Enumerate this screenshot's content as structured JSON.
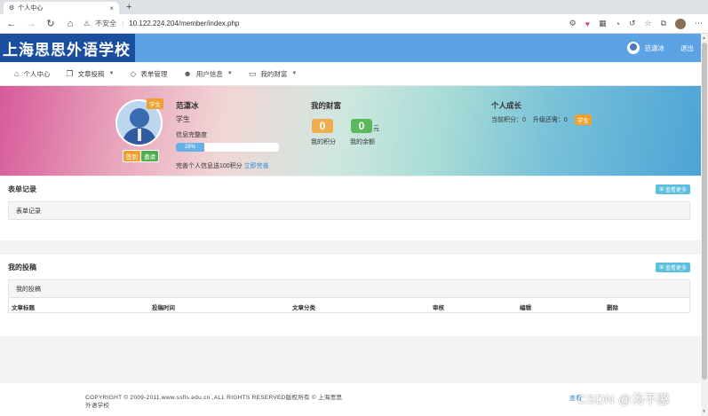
{
  "browser": {
    "tab_title": "个人中心",
    "url_warning": "不安全",
    "url": "10.122.224.204/member/index.php"
  },
  "header": {
    "logo_text": "上海思思外语学校",
    "username": "范潇冰",
    "logout": "退出"
  },
  "nav": {
    "items": [
      {
        "label": "个人中心",
        "icon": "home-icon"
      },
      {
        "label": "文章投稿",
        "icon": "document-icon"
      },
      {
        "label": "表单管理",
        "icon": "diamond-icon"
      },
      {
        "label": "用户信息",
        "icon": "user-icon"
      },
      {
        "label": "我的财富",
        "icon": "card-icon"
      }
    ]
  },
  "profile": {
    "role_badge": "学生",
    "sign_label": "签到",
    "invite_label": "邀请",
    "name": "范潇冰",
    "role": "学生",
    "completeness_label": "信息完整度",
    "completeness_value": "28%",
    "completeness_percent": 28,
    "hint": "完善个人信息送100积分",
    "hint_link": "立即完善"
  },
  "wealth": {
    "title": "我的财富",
    "points_value": "0",
    "balance_value": "0",
    "yuan": "元",
    "points_label": "我的积分",
    "balance_label": "我的余额"
  },
  "growth": {
    "title": "个人成长",
    "current_points": "当前积分：0",
    "upgrade_needed": "升级还需：0",
    "level_badge": "学生"
  },
  "forms_section": {
    "title": "表单记录",
    "more_btn": "查看更多",
    "box_label": "表单记录"
  },
  "posts_section": {
    "title": "我的投稿",
    "more_btn": "查看更多",
    "box_label": "我的投稿",
    "columns": [
      "文章标题",
      "投稿时间",
      "文章分类",
      "审核",
      "编辑",
      "删除"
    ]
  },
  "footer": {
    "copyright": "COPYRIGHT © 2009-2011,www.ssfls.edu.cn ,ALL RIGHTS RESERVED版权所有 © 上海思思外语学校",
    "link": "查看",
    "watermark": "CSDN @汤不憨"
  },
  "colors": {
    "header_blue": "#5ca3e4",
    "logo_navy": "#1a4fa0",
    "accent_orange": "#f0a030",
    "accent_green": "#5cb85c",
    "info_cyan": "#5bc0de"
  }
}
